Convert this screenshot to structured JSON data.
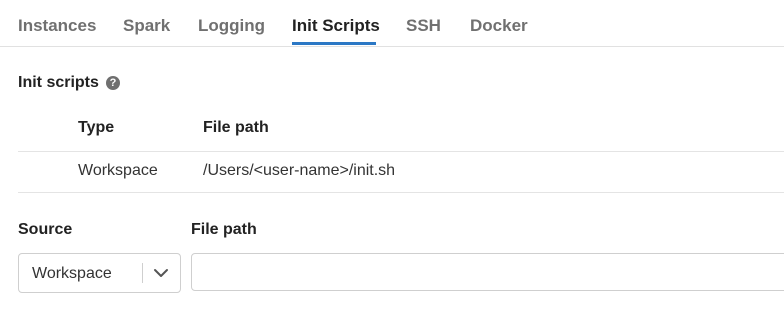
{
  "tabs": [
    {
      "label": "Instances",
      "active": false
    },
    {
      "label": "Spark",
      "active": false
    },
    {
      "label": "Logging",
      "active": false
    },
    {
      "label": "Init Scripts",
      "active": true
    },
    {
      "label": "SSH",
      "active": false
    },
    {
      "label": "Docker",
      "active": false
    }
  ],
  "section": {
    "title": "Init scripts",
    "help_icon": "question-circle-icon",
    "help_glyph": "?"
  },
  "table": {
    "headers": {
      "type": "Type",
      "file_path": "File path"
    },
    "rows": [
      {
        "type": "Workspace",
        "file_path": "/Users/<user-name>/init.sh"
      }
    ]
  },
  "form": {
    "source_label": "Source",
    "source_value": "Workspace",
    "file_path_label": "File path",
    "file_path_value": "",
    "file_path_placeholder": ""
  },
  "colors": {
    "accent": "#2b78c5",
    "text": "#333333",
    "muted_tab": "#707070",
    "border": "#cfcfcf"
  }
}
